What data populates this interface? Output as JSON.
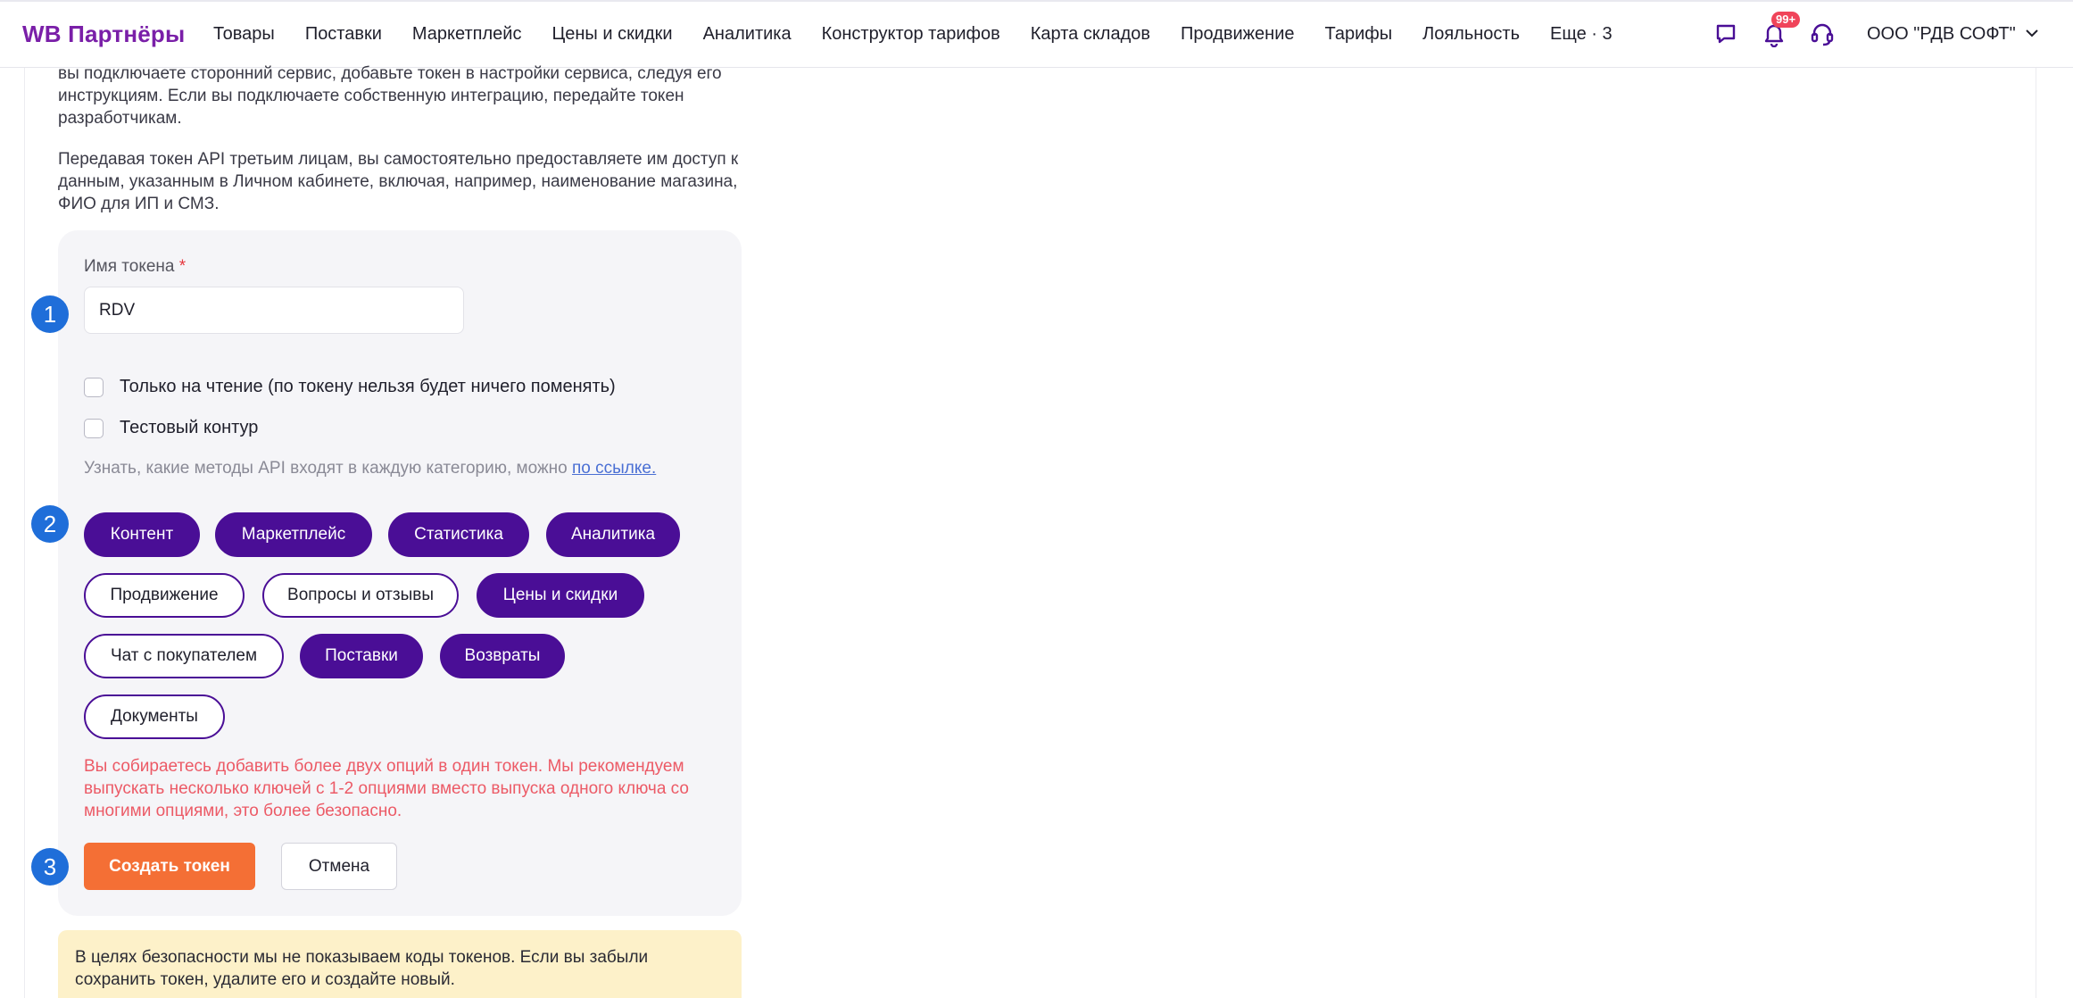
{
  "header": {
    "brand": "WB Партнёры",
    "nav": [
      "Товары",
      "Поставки",
      "Маркетплейс",
      "Цены и скидки",
      "Аналитика",
      "Конструктор тарифов",
      "Карта складов",
      "Продвижение",
      "Тарифы",
      "Лояльность",
      "Еще · 3"
    ],
    "notification_badge": "99+",
    "account": "ООО \"РДВ СОФТ\"",
    "icons": [
      "chat-icon",
      "bell-icon",
      "support-headset-icon",
      "chevron-down-icon"
    ]
  },
  "intro": {
    "p1": "вы подключаете сторонний сервис, добавьте токен в настройки сервиса, следуя его инструкциям. Если вы подключаете собственную интеграцию, передайте токен разработчикам.",
    "p2": "Передавая токен API третьим лицам, вы самостоятельно предоставляете им доступ к данным, указанным в Личном кабинете, включая, например, наименование магазина, ФИО для ИП и СМЗ."
  },
  "form": {
    "name_label": "Имя токена",
    "required_mark": "*",
    "name_value": "RDV",
    "readonly_label": "Только на чтение (по токену нельзя будет ничего поменять)",
    "readonly_checked": false,
    "test_label": "Тестовый контур",
    "test_checked": false,
    "hint_text": "Узнать, какие методы API входят в каждую категорию, можно ",
    "hint_link": "по ссылке.",
    "categories": [
      {
        "label": "Контент",
        "selected": true
      },
      {
        "label": "Маркетплейс",
        "selected": true
      },
      {
        "label": "Статистика",
        "selected": true
      },
      {
        "label": "Аналитика",
        "selected": true
      },
      {
        "label": "Продвижение",
        "selected": false
      },
      {
        "label": "Вопросы и отзывы",
        "selected": false
      },
      {
        "label": "Цены и скидки",
        "selected": true
      },
      {
        "label": "Чат с покупателем",
        "selected": false
      },
      {
        "label": "Поставки",
        "selected": true
      },
      {
        "label": "Возвраты",
        "selected": true
      },
      {
        "label": "Документы",
        "selected": false
      }
    ],
    "warning": "Вы собираетесь добавить более двух опций в один токен. Мы рекомендуем выпускать несколько ключей с 1-2 опциями вместо выпуска одного ключа со многими опциями, это более безопасно.",
    "create_button": "Создать токен",
    "cancel_button": "Отмена"
  },
  "steps": [
    "1",
    "2",
    "3"
  ],
  "notice": "В целях безопасности мы не показываем коды токенов. Если вы забыли сохранить токен, удалите его и создайте новый.",
  "colors": {
    "brand": "#7a1fa8",
    "chip_active": "#4a0e96",
    "primary_button": "#f46f35",
    "step_marker": "#1f6ed9",
    "warning_text": "#ec5a66",
    "notice_bg": "#fdf1c9"
  }
}
